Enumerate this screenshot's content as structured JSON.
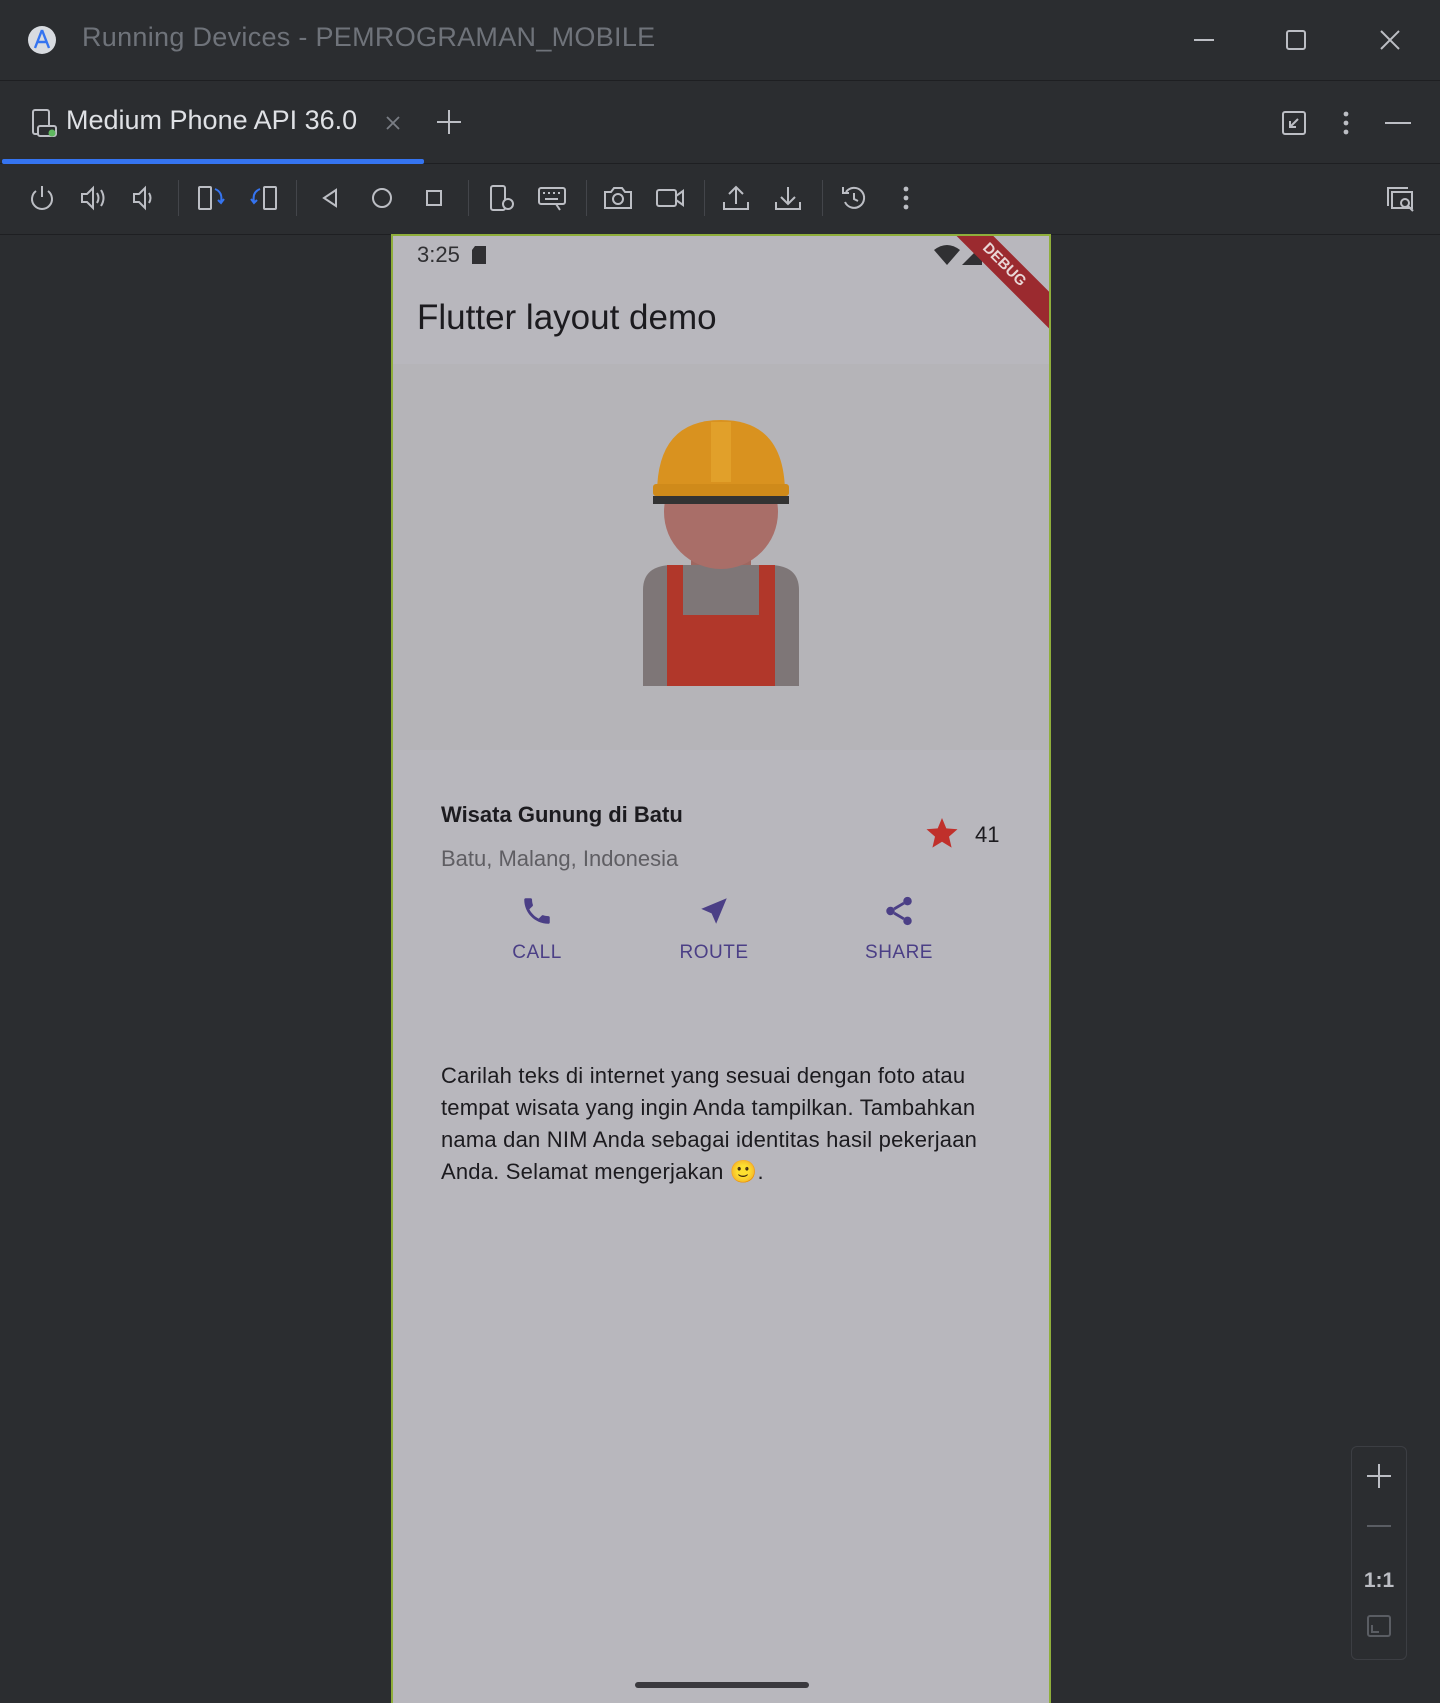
{
  "window": {
    "title": "Running Devices - PEMROGRAMAN_MOBILE"
  },
  "tabs": [
    {
      "label": "Medium Phone API 36.0",
      "active": true
    }
  ],
  "toolbar_icons": [
    "power-icon",
    "volume-up-icon",
    "volume-down-icon",
    "rotate-left-icon",
    "rotate-right-icon",
    "back-icon",
    "home-icon",
    "overview-icon",
    "device-settings-icon",
    "keyboard-icon",
    "camera-icon",
    "video-icon",
    "upload-icon",
    "download-icon",
    "reset-icon",
    "more-icon",
    "device-mirror-icon"
  ],
  "device": {
    "status_time": "3:25",
    "debug_banner": "DEBUG",
    "appbar_title": "Flutter layout demo",
    "place": {
      "title": "Wisata Gunung di Batu",
      "subtitle": "Batu, Malang, Indonesia",
      "rating": "41"
    },
    "actions": [
      {
        "label": "CALL",
        "icon": "phone-icon"
      },
      {
        "label": "ROUTE",
        "icon": "navigation-icon"
      },
      {
        "label": "SHARE",
        "icon": "share-icon"
      }
    ],
    "description": "Carilah teks di internet yang sesuai dengan foto atau tempat wisata yang ingin Anda tampilkan. Tambahkan nama dan NIM Anda sebagai identitas hasil pekerjaan Anda. Selamat mengerjakan 🙂."
  },
  "zoom": {
    "reset_label": "1:1"
  },
  "colors": {
    "accent": "#3574f0",
    "device_bg": "#b8b7bd",
    "action_color": "#4b3f86",
    "star_color": "#c0302b"
  }
}
